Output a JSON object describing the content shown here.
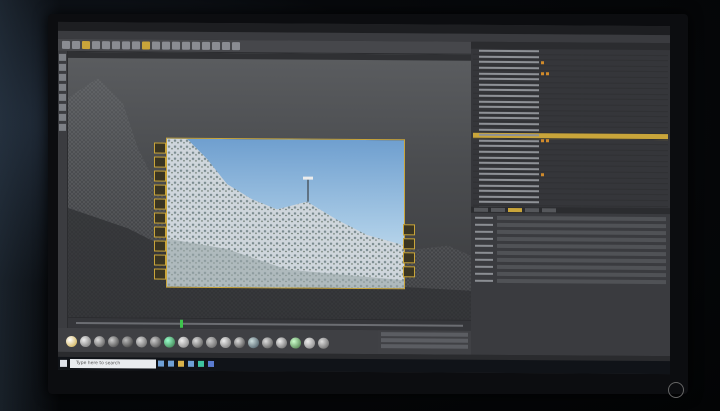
{
  "scene": "photo-of-monitor",
  "app": {
    "kind": "3d-editor"
  },
  "taskbar": {
    "search_placeholder": "Type here to search"
  },
  "colors": {
    "accent": "#c9a53a",
    "viewport_bg": "#4b4d50",
    "sky_top": "#6f9fcf",
    "snow": "#dfe4e8",
    "green_playhead": "#3ec44d"
  },
  "icons": [
    "windows-start-icon",
    "search-icon",
    "folder-icon",
    "browser-icon",
    "power-icon"
  ]
}
